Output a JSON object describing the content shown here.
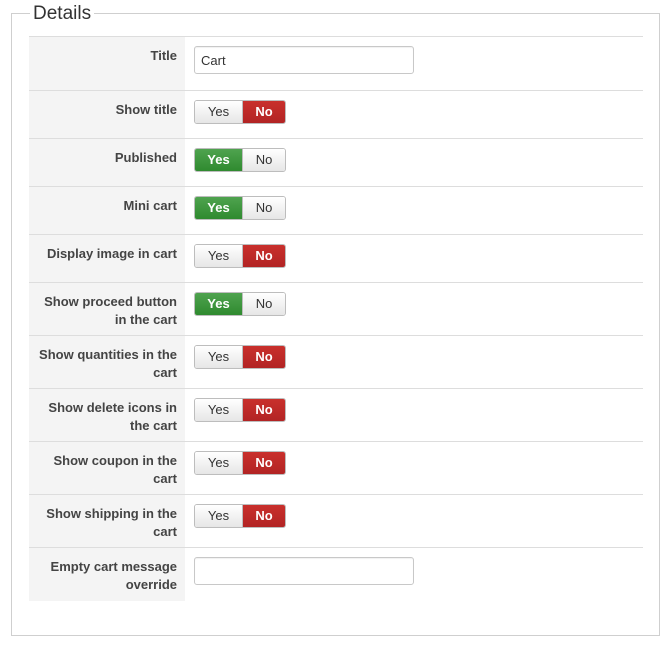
{
  "fieldset": {
    "legend": "Details"
  },
  "fields": {
    "title": {
      "label": "Title",
      "value": "Cart",
      "placeholder": ""
    },
    "show_title": {
      "label": "Show title",
      "yes": "Yes",
      "no": "No",
      "selected": "no"
    },
    "published": {
      "label": "Published",
      "yes": "Yes",
      "no": "No",
      "selected": "yes"
    },
    "mini_cart": {
      "label": "Mini cart",
      "yes": "Yes",
      "no": "No",
      "selected": "yes"
    },
    "display_image": {
      "label": "Display image in cart",
      "yes": "Yes",
      "no": "No",
      "selected": "no"
    },
    "show_proceed": {
      "label_line1": "Show proceed button",
      "label_line2": "in the cart",
      "yes": "Yes",
      "no": "No",
      "selected": "yes"
    },
    "show_quantities": {
      "label_line1": "Show quantities in the",
      "label_line2": "cart",
      "yes": "Yes",
      "no": "No",
      "selected": "no"
    },
    "show_delete": {
      "label_line1": "Show delete icons in",
      "label_line2": "the cart",
      "yes": "Yes",
      "no": "No",
      "selected": "no"
    },
    "show_coupon": {
      "label_line1": "Show coupon in the",
      "label_line2": "cart",
      "yes": "Yes",
      "no": "No",
      "selected": "no"
    },
    "show_shipping": {
      "label_line1": "Show shipping in the",
      "label_line2": "cart",
      "yes": "Yes",
      "no": "No",
      "selected": "no"
    },
    "empty_message": {
      "label_line1": "Empty cart message",
      "label_line2": "override",
      "value": "",
      "placeholder": ""
    }
  },
  "colors": {
    "yes_active": "#3c963c",
    "no_active": "#bd2c28"
  }
}
